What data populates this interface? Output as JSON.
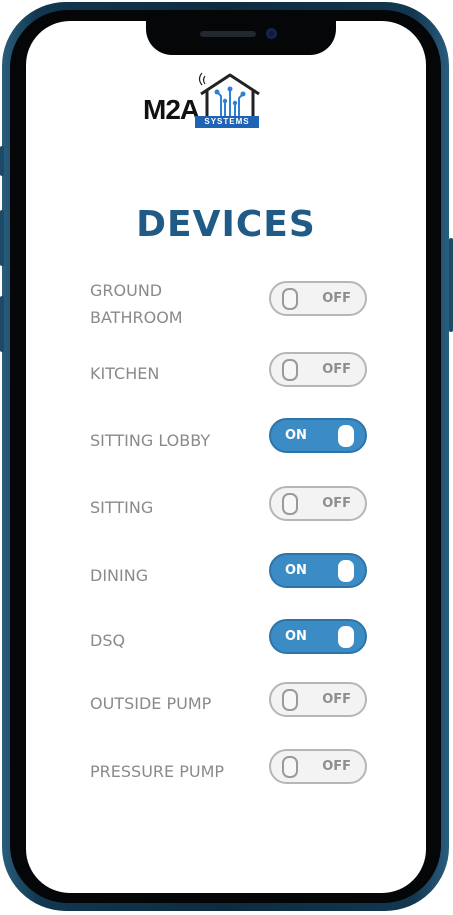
{
  "brand": {
    "name": "M2A",
    "tagline": "SYSTEMS"
  },
  "page": {
    "title": "DEVICES"
  },
  "colors": {
    "accent": "#1f5b86",
    "toggle_on": "#3b8bc5",
    "toggle_off": "#f3f3f3"
  },
  "devices": [
    {
      "line1": "GROUND",
      "line2": "BATHROOM",
      "state": "OFF"
    },
    {
      "line1": "KITCHEN",
      "state": "OFF"
    },
    {
      "line1": "SITTING LOBBY",
      "state": "ON"
    },
    {
      "line1": "SITTING",
      "state": "OFF"
    },
    {
      "line1": "DINING",
      "state": "ON"
    },
    {
      "line1": "DSQ",
      "state": "ON"
    },
    {
      "line1": "OUTSIDE PUMP",
      "state": "OFF"
    },
    {
      "line1": "PRESSURE PUMP",
      "state": "OFF"
    }
  ]
}
